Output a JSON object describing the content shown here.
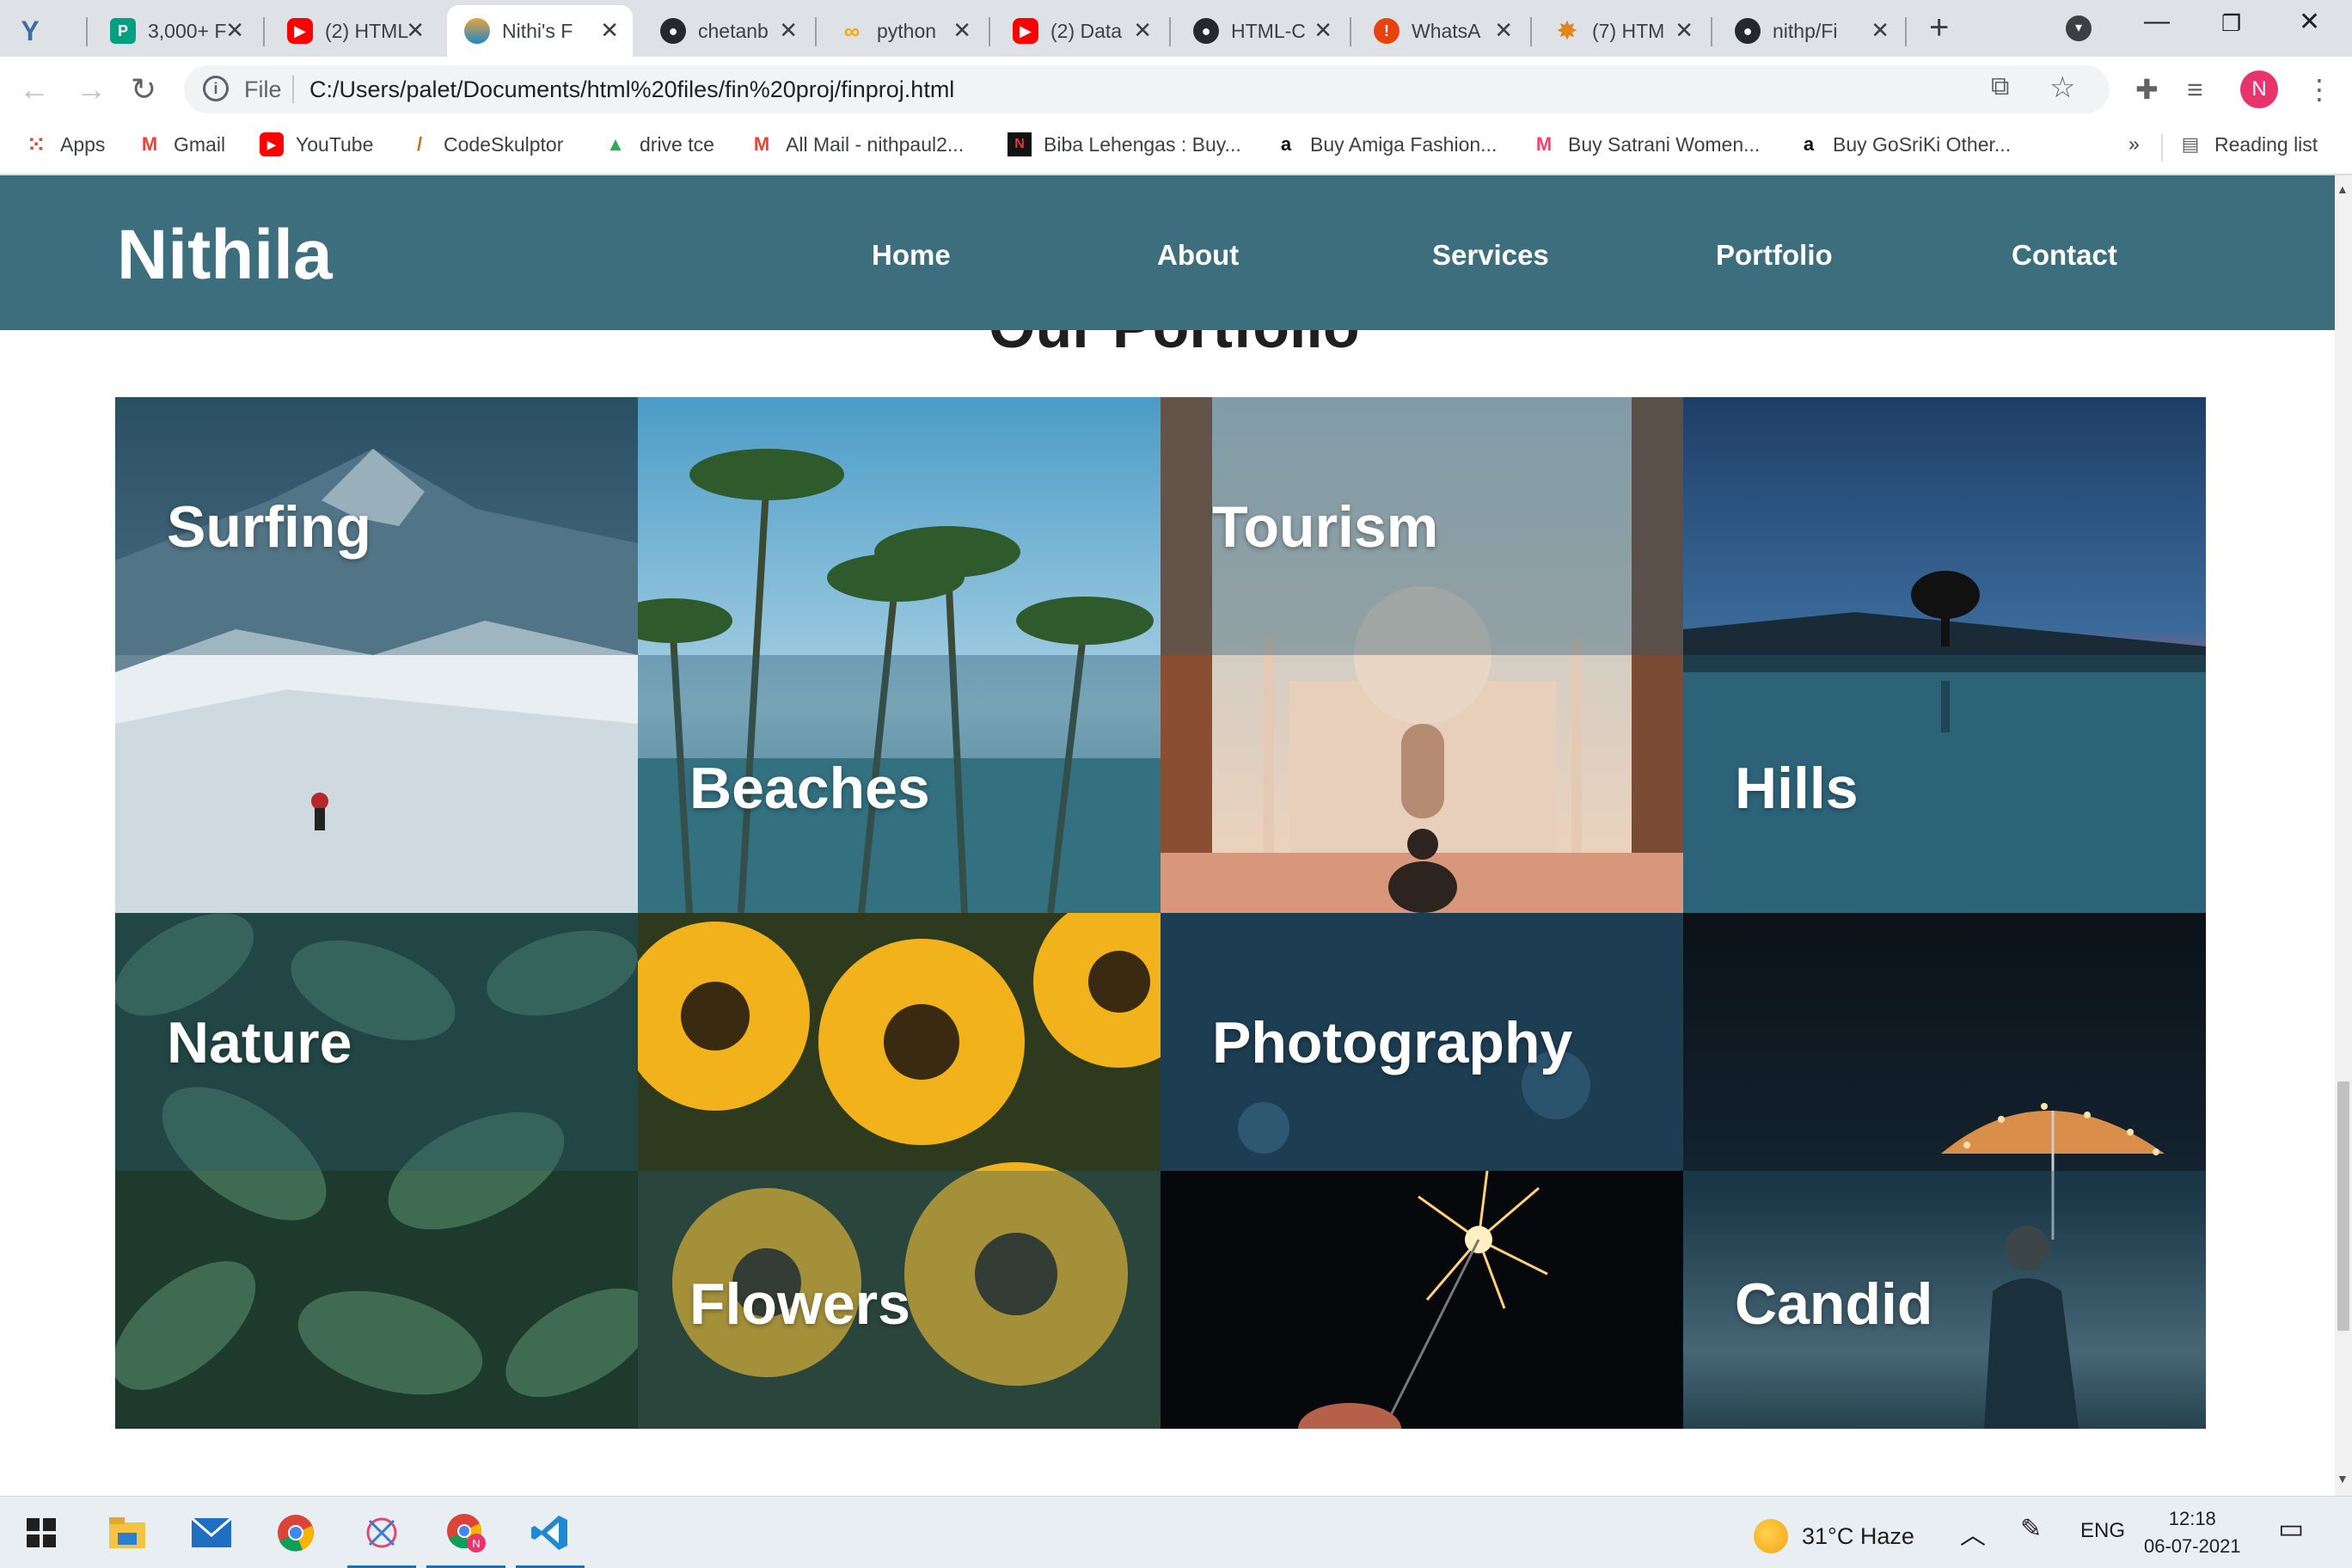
{
  "browser": {
    "tabs": [
      {
        "title": "",
        "icon": "vivaldi-icon"
      },
      {
        "title": "3,000+ F",
        "icon": "pexels-icon"
      },
      {
        "title": "(2) HTML",
        "icon": "youtube-icon"
      },
      {
        "title": "Nithi's F",
        "icon": "site-icon",
        "active": true
      },
      {
        "title": "chetanb",
        "icon": "github-icon"
      },
      {
        "title": "python",
        "icon": "colab-icon"
      },
      {
        "title": "(2) Data",
        "icon": "youtube-icon"
      },
      {
        "title": "HTML-C",
        "icon": "github-icon"
      },
      {
        "title": "WhatsA",
        "icon": "whatsapp-alert-icon"
      },
      {
        "title": "(7) HTM",
        "icon": "sparkle-icon"
      },
      {
        "title": "nithp/Fi",
        "icon": "github-icon"
      }
    ],
    "address": {
      "protocol": "File",
      "url": "C:/Users/palet/Documents/html%20files/fin%20proj/finproj.html"
    },
    "profile_initial": "N",
    "bookmarks": [
      {
        "label": "Apps",
        "icon": "apps-grid-icon"
      },
      {
        "label": "Gmail",
        "icon": "gmail-icon"
      },
      {
        "label": "YouTube",
        "icon": "youtube-icon"
      },
      {
        "label": "CodeSkulptor",
        "icon": "codeskulptor-icon"
      },
      {
        "label": "drive tce",
        "icon": "google-drive-icon"
      },
      {
        "label": "All Mail - nithpaul2...",
        "icon": "gmail-icon"
      },
      {
        "label": "Biba Lehengas : Buy...",
        "icon": "biba-icon"
      },
      {
        "label": "Buy Amiga Fashion...",
        "icon": "amazon-icon"
      },
      {
        "label": "Buy Satrani Women...",
        "icon": "myntra-icon"
      },
      {
        "label": "Buy GoSriKi Other...",
        "icon": "amazon-icon"
      }
    ],
    "reading_list": "Reading list",
    "overflow": "»"
  },
  "site": {
    "logo": "Nithila",
    "nav": [
      "Home",
      "About",
      "Services",
      "Portfolio",
      "Contact"
    ],
    "section_title": "Our Portfolio",
    "tiles": [
      {
        "label": "Surfing",
        "scene": "snowy-mountain"
      },
      {
        "label": "Beaches",
        "scene": "palm-trees"
      },
      {
        "label": "Tourism",
        "scene": "taj-mahal"
      },
      {
        "label": "Hills",
        "scene": "sunset-lake"
      },
      {
        "label": "Nature",
        "scene": "green-leaves"
      },
      {
        "label": "Flowers",
        "scene": "sunflowers"
      },
      {
        "label": "Photography",
        "scene": "sparkler"
      },
      {
        "label": "Candid",
        "scene": "umbrella-lights"
      }
    ]
  },
  "taskbar": {
    "weather": "31°C  Haze",
    "language": "ENG",
    "time": "12:18",
    "date": "06-07-2021"
  }
}
